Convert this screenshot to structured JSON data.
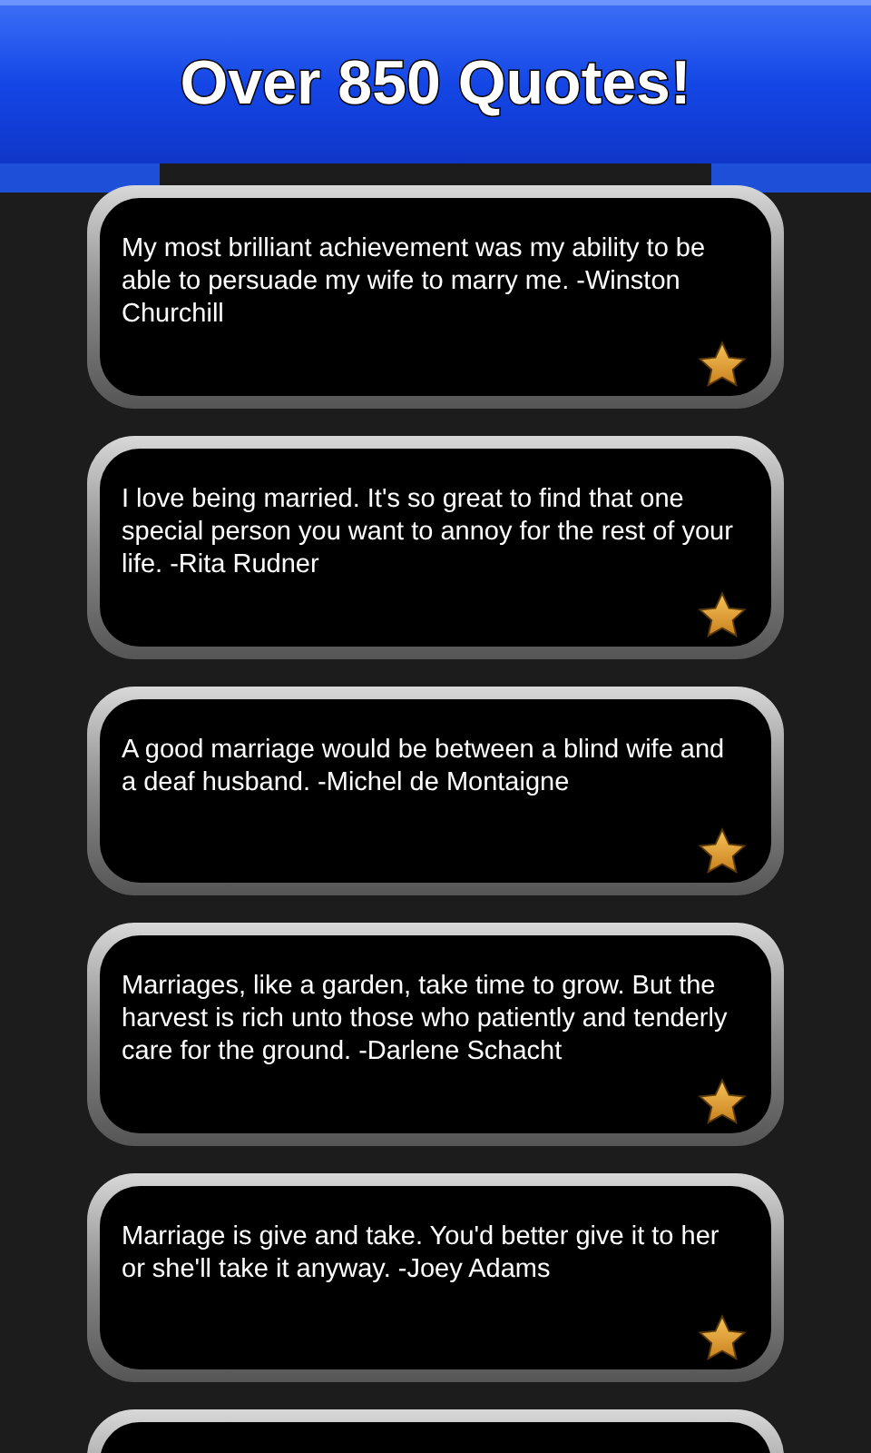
{
  "header": {
    "title": "Over 850 Quotes!"
  },
  "quotes": [
    {
      "text": "My most brilliant achievement was my ability to be able to persuade my wife to marry me. -Winston Churchill"
    },
    {
      "text": "I love being married. It's so great to find that one special person you want to annoy for the rest of your life. -Rita Rudner"
    },
    {
      "text": "A good marriage would be between a blind wife and a deaf husband. -Michel de Montaigne"
    },
    {
      "text": "Marriages, like a garden, take time to grow. But the harvest is rich unto those who patiently and tenderly care for the ground. -Darlene Schacht"
    },
    {
      "text": "Marriage is give and take. You'd better give it to her or she'll take it anyway. -Joey Adams"
    }
  ]
}
